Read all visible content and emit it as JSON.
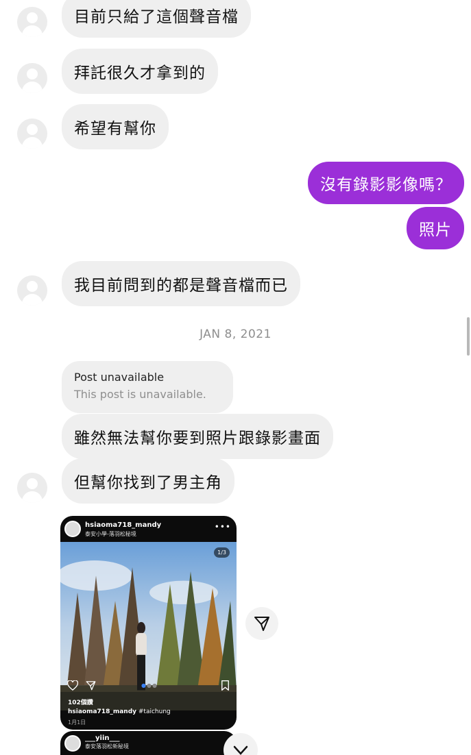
{
  "messages": [
    {
      "text": "目前只給了這個聲音檔"
    },
    {
      "text": "拜託很久才拿到的"
    },
    {
      "text": "希望有幫你"
    },
    {
      "text": "沒有錄影影像嗎？"
    },
    {
      "text": "照片"
    },
    {
      "text": "我目前問到的都是聲音檔而已"
    },
    {
      "text": "雖然無法幫你要到照片跟錄影畫面"
    },
    {
      "text": "但幫你找到了男主角"
    }
  ],
  "date_divider": "JAN 8, 2021",
  "post_unavailable": {
    "title": "Post unavailable",
    "subtitle": "This post is unavailable."
  },
  "shared_post": {
    "username": "hsiaoma718_mandy",
    "location": "泰安小學-落羽松秘境",
    "counter": "1/3",
    "likes": "102個讚",
    "caption_user": "hsiaoma718_mandy",
    "caption_text": "#taichung",
    "date": "1月1日"
  },
  "shared_post_2": {
    "username": "___yiin___",
    "location": "泰安落羽松新秘境"
  },
  "colors": {
    "outgoing_bubble": "#9b2fd8",
    "incoming_bubble": "#efefef"
  },
  "icons": [
    "avatar-placeholder",
    "share-icon",
    "heart-icon",
    "send-icon",
    "bookmark-icon",
    "more-icon",
    "close-icon"
  ]
}
